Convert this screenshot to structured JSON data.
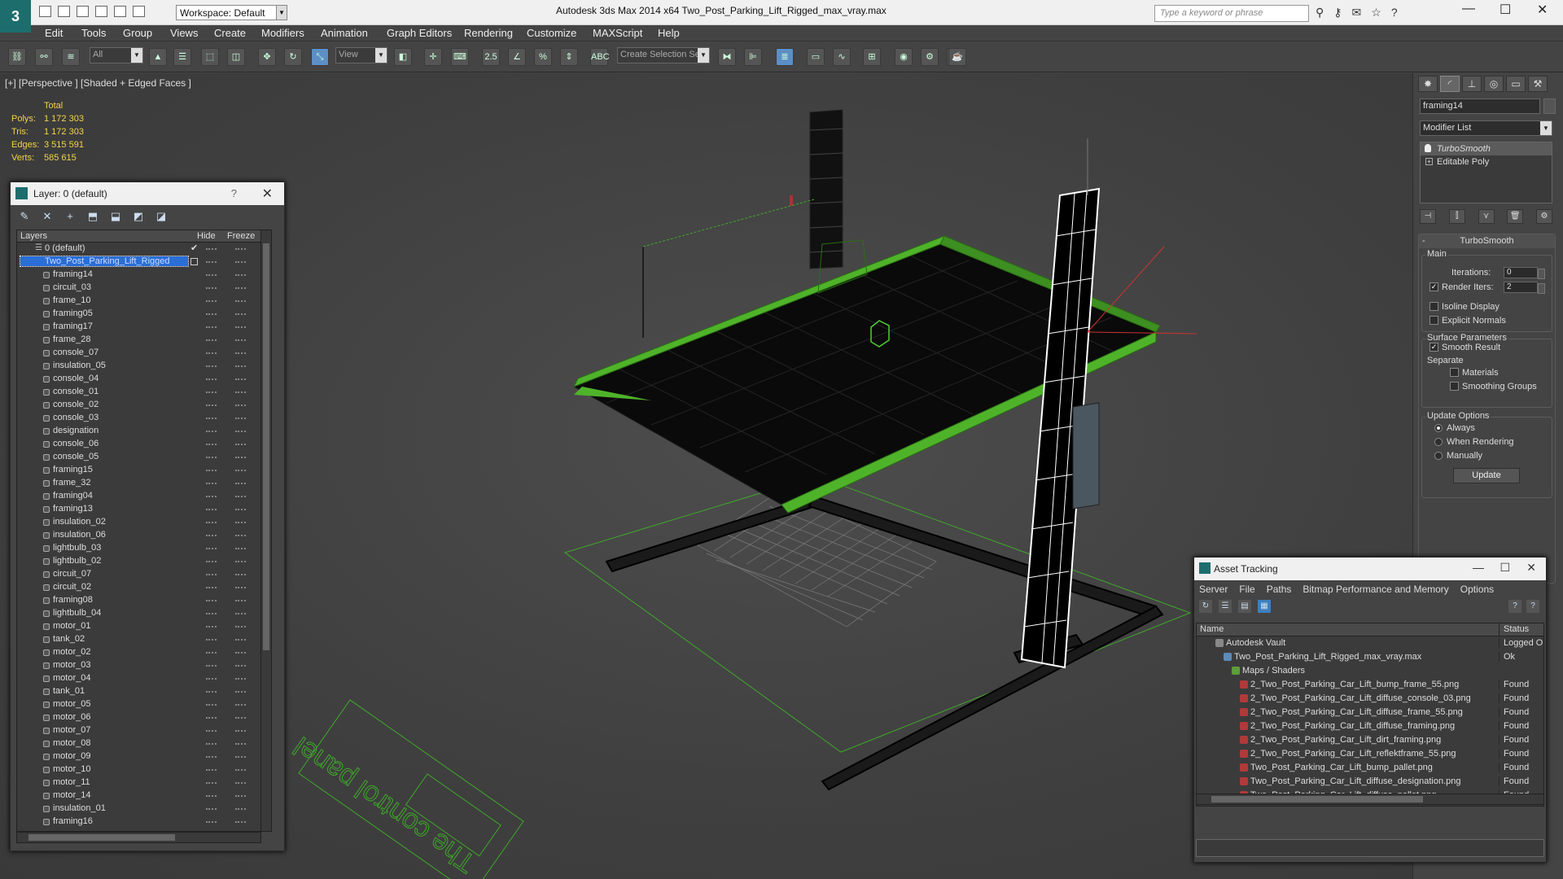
{
  "app": {
    "logo": "3",
    "workspace": "Workspace: Default",
    "title": "Autodesk 3ds Max  2014 x64      Two_Post_Parking_Lift_Rigged_max_vray.max",
    "search_placeholder": "Type a keyword or phrase"
  },
  "menu": [
    "Edit",
    "Tools",
    "Group",
    "Views",
    "Create",
    "Modifiers",
    "Animation",
    "Graph Editors",
    "Rendering",
    "Customize",
    "MAXScript",
    "Help"
  ],
  "toolbar": {
    "selection_filter": "All",
    "ref_coord": "View",
    "named_selection": "Create Selection Se",
    "snap_label": "2.5"
  },
  "viewport": {
    "label": "[+] [Perspective ] [Shaded + Edged Faces ]",
    "stats": {
      "header": "Total",
      "rows": [
        {
          "label": "Polys:",
          "value": "1 172 303"
        },
        {
          "label": "Tris:",
          "value": "1 172 303"
        },
        {
          "label": "Edges:",
          "value": "3 515 591"
        },
        {
          "label": "Verts:",
          "value": "585 615"
        }
      ]
    },
    "floor_text": "The control panel"
  },
  "command_panel": {
    "object_name": "framing14",
    "modifier_list": "Modifier List",
    "stack": [
      "TurboSmooth",
      "Editable Poly"
    ],
    "rollout_title": "TurboSmooth",
    "main_label": "Main",
    "iterations_label": "Iterations:",
    "iterations_value": "0",
    "render_iters_label": "Render Iters:",
    "render_iters_value": "2",
    "isoline_label": "Isoline Display",
    "explicit_label": "Explicit Normals",
    "surface_label": "Surface Parameters",
    "smooth_label": "Smooth Result",
    "separate_label": "Separate",
    "materials_label": "Materials",
    "smoothing_label": "Smoothing Groups",
    "update_options_label": "Update Options",
    "always_label": "Always",
    "when_rendering_label": "When Rendering",
    "manually_label": "Manually",
    "update_button": "Update"
  },
  "layer_panel": {
    "title": "Layer: 0 (default)",
    "help": "?",
    "col_layers": "Layers",
    "col_hide": "Hide",
    "col_freeze": "Freeze",
    "default_layer": "0 (default)",
    "selected_layer": "Two_Post_Parking_Lift_Rigged",
    "objects": [
      "framing14",
      "circuit_03",
      "frame_10",
      "framing05",
      "framing17",
      "frame_28",
      "console_07",
      "insulation_05",
      "console_04",
      "console_01",
      "console_02",
      "console_03",
      "designation",
      "console_06",
      "console_05",
      "framing15",
      "frame_32",
      "framing04",
      "framing13",
      "insulation_02",
      "insulation_06",
      "lightbulb_03",
      "lightbulb_02",
      "circuit_07",
      "circuit_02",
      "framing08",
      "lightbulb_04",
      "motor_01",
      "tank_02",
      "motor_02",
      "motor_03",
      "motor_04",
      "tank_01",
      "motor_05",
      "motor_06",
      "motor_07",
      "motor_08",
      "motor_09",
      "motor_10",
      "motor_11",
      "motor_14",
      "insulation_01",
      "framing16"
    ]
  },
  "asset_panel": {
    "title": "Asset Tracking",
    "menu": [
      "Server",
      "File",
      "Paths",
      "Bitmap Performance and Memory",
      "Options"
    ],
    "col_name": "Name",
    "col_status": "Status",
    "rows": [
      {
        "name": "Autodesk Vault",
        "status": "Logged O",
        "indent": 2,
        "kind": "vault"
      },
      {
        "name": "Two_Post_Parking_Lift_Rigged_max_vray.max",
        "status": "Ok",
        "indent": 3,
        "kind": "max"
      },
      {
        "name": "Maps / Shaders",
        "status": "",
        "indent": 4,
        "kind": "maps"
      },
      {
        "name": "2_Two_Post_Parking_Car_Lift_bump_frame_55.png",
        "status": "Found",
        "indent": 5,
        "kind": "png"
      },
      {
        "name": "2_Two_Post_Parking_Car_Lift_diffuse_console_03.png",
        "status": "Found",
        "indent": 5,
        "kind": "png"
      },
      {
        "name": "2_Two_Post_Parking_Car_Lift_diffuse_frame_55.png",
        "status": "Found",
        "indent": 5,
        "kind": "png"
      },
      {
        "name": "2_Two_Post_Parking_Car_Lift_diffuse_framing.png",
        "status": "Found",
        "indent": 5,
        "kind": "png"
      },
      {
        "name": "2_Two_Post_Parking_Car_Lift_dirt_framing.png",
        "status": "Found",
        "indent": 5,
        "kind": "png"
      },
      {
        "name": "2_Two_Post_Parking_Car_Lift_reflektframe_55.png",
        "status": "Found",
        "indent": 5,
        "kind": "png"
      },
      {
        "name": "Two_Post_Parking_Car_Lift_bump_pallet.png",
        "status": "Found",
        "indent": 5,
        "kind": "png"
      },
      {
        "name": "Two_Post_Parking_Car_Lift_diffuse_designation.png",
        "status": "Found",
        "indent": 5,
        "kind": "png"
      },
      {
        "name": "Two_Post_Parking_Car_Lift_diffuse_pallet.png",
        "status": "Found",
        "indent": 5,
        "kind": "png"
      }
    ]
  },
  "colors": {
    "accent": "#2a6ed6",
    "wire_green": "#4fb32a",
    "stats": "#f3d34a"
  }
}
